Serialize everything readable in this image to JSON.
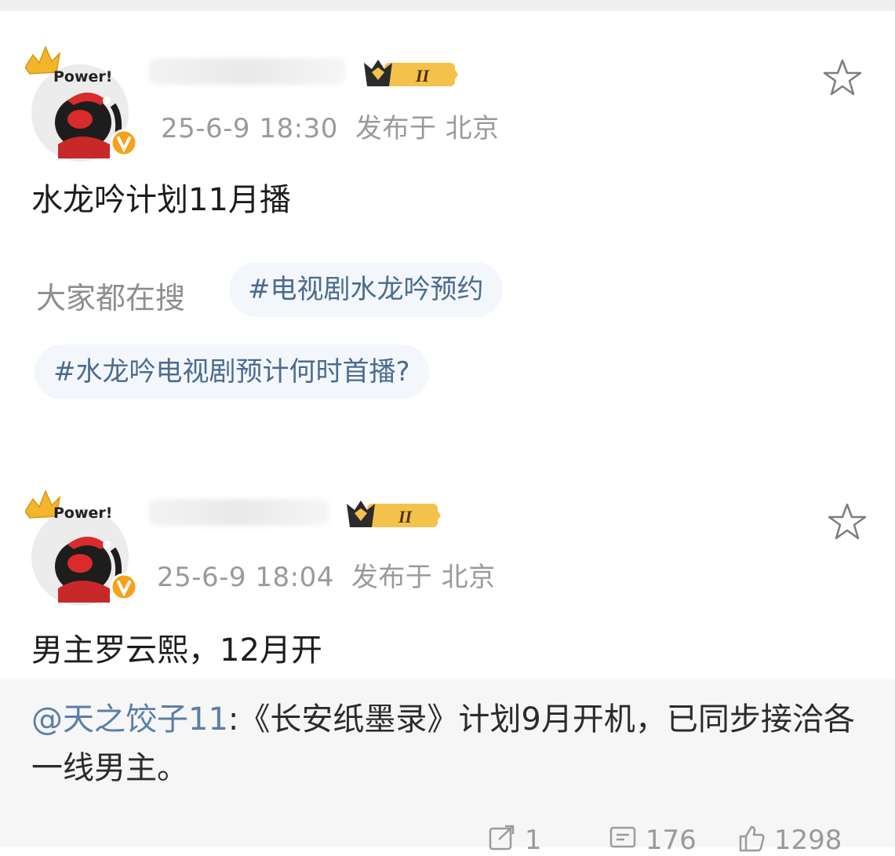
{
  "posts": [
    {
      "avatar_text": "Power!",
      "timestamp": "25-6-9 18:30",
      "location": "发布于 北京",
      "vip_level": "II",
      "content": "水龙吟计划11月播",
      "search_label": "大家都在搜",
      "tags": [
        "#电视剧水龙吟预约",
        "#水龙吟电视剧预计何时首播?"
      ]
    },
    {
      "avatar_text": "Power!",
      "timestamp": "25-6-9 18:04",
      "location": "发布于 北京",
      "vip_level": "II",
      "content": "男主罗云熙，12月开",
      "repost": {
        "mention": "@天之饺子11",
        "text": ":《长安纸墨录》计划9月开机，已同步接洽各一线男主。"
      }
    }
  ],
  "actions": {
    "share_count": "1",
    "comment_count": "176",
    "like_count": "1298"
  },
  "colors": {
    "meta_gray": "#9a9a9a",
    "tag_bg": "#f3f7fb",
    "tag_text": "#4a6b8f",
    "mention": "#5a7fa8",
    "badge_gold": "#f3b62b",
    "verified_orange": "#f7a21b"
  },
  "icons": [
    "crown-icon",
    "verified-badge-icon",
    "vip-crown-badge-icon",
    "star-icon",
    "share-icon",
    "comment-icon",
    "like-icon"
  ]
}
